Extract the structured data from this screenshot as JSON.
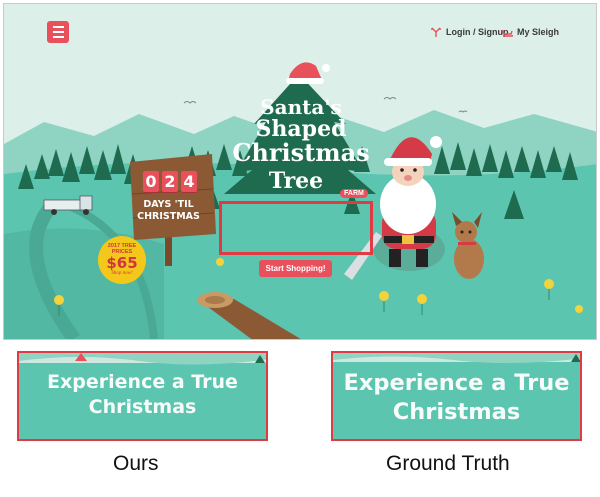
{
  "screenshot": {
    "nav": {
      "menu_icon": "hamburger-menu-icon",
      "login_label": "Login / Signup",
      "login_icon": "reindeer-icon",
      "sleigh_label": "My Sleigh",
      "sleigh_icon": "sleigh-icon"
    },
    "logo": {
      "line1": "Santa's",
      "line2": "Shaped",
      "line3": "Christmas",
      "line4": "Tree",
      "farm_tag": "FARM"
    },
    "countdown": {
      "digits": [
        "0",
        "2",
        "4"
      ],
      "line1": "DAYS 'TIL",
      "line2": "CHRISTMAS"
    },
    "price_badge": {
      "line1": "2017 TREE",
      "line2": "PRICES",
      "price": "$65",
      "tagline": "Shop now!"
    },
    "cta_label": "Start Shopping!",
    "colors": {
      "accent": "#e8505b",
      "mint": "#5cc5b0",
      "sky": "#dcefe9",
      "tree": "#1e6b4f",
      "highlight_box": "#e03a45"
    }
  },
  "comparison": {
    "ours": {
      "line1": "Experience a True",
      "line2": "Christmas",
      "caption": "Ours"
    },
    "ground_truth": {
      "line1": "Experience a True",
      "line2": "Christmas",
      "caption": "Ground Truth"
    }
  }
}
